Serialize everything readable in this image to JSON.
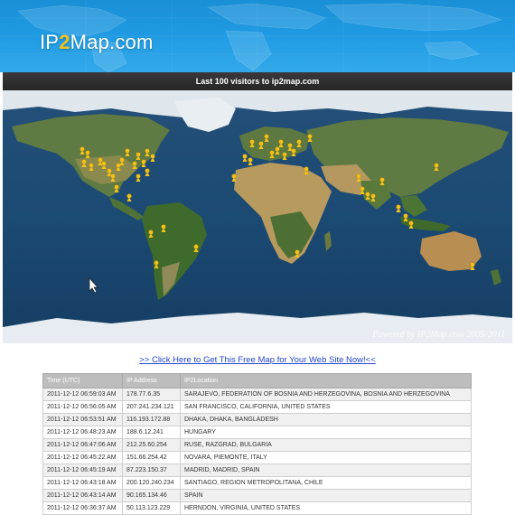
{
  "header": {
    "logo_prefix": "IP",
    "logo_two": "2",
    "logo_suffix": "Map.com",
    "visitors_title": "Last 100 visitors to ip2map.com"
  },
  "map": {
    "powered_text": "Powered by IP2Map.com 2005-2011",
    "pin_color": "#f2c21a"
  },
  "cta": {
    "link_text": ">> Click Here to Get This Free Map for Your Web Site Now!<<"
  },
  "table": {
    "columns": [
      "Time (UTC)",
      "IP Address",
      "IP2Location"
    ],
    "rows": [
      [
        "2011-12-12 06:59:03 AM",
        "178.77.6.35",
        "SARAJEVO, FEDERATION OF BOSNIA AND HERZEGOVINA, BOSNIA AND HERZEGOVINA"
      ],
      [
        "2011-12-12 06:56:05 AM",
        "207.241.234.121",
        "SAN FRANCISCO, CALIFORNIA, UNITED STATES"
      ],
      [
        "2011-12-12 06:53:51 AM",
        "116.193.172.88",
        "DHAKA, DHAKA, BANGLADESH"
      ],
      [
        "2011-12-12 06:48:23 AM",
        "188.6.12.241",
        "HUNGARY"
      ],
      [
        "2011-12-12 06:47:06 AM",
        "212.25.60.254",
        "RUSE, RAZGRAD, BULGARIA"
      ],
      [
        "2011-12-12 06:45:22 AM",
        "151.66.254.42",
        "NOVARA, PIEMONTE, ITALY"
      ],
      [
        "2011-12-12 06:45:19 AM",
        "87.223.150.37",
        "MADRID, MADRID, SPAIN"
      ],
      [
        "2011-12-12 06:43:18 AM",
        "200.120.240.234",
        "SANTIAGO, REGION METROPOLITANA, CHILE"
      ],
      [
        "2011-12-12 06:43:14 AM",
        "90.165.134.46",
        "SPAIN"
      ],
      [
        "2011-12-12 06:36:37 AM",
        "50.113.123.229",
        "HERNDON, VIRGINIA, UNITED STATES"
      ]
    ]
  }
}
